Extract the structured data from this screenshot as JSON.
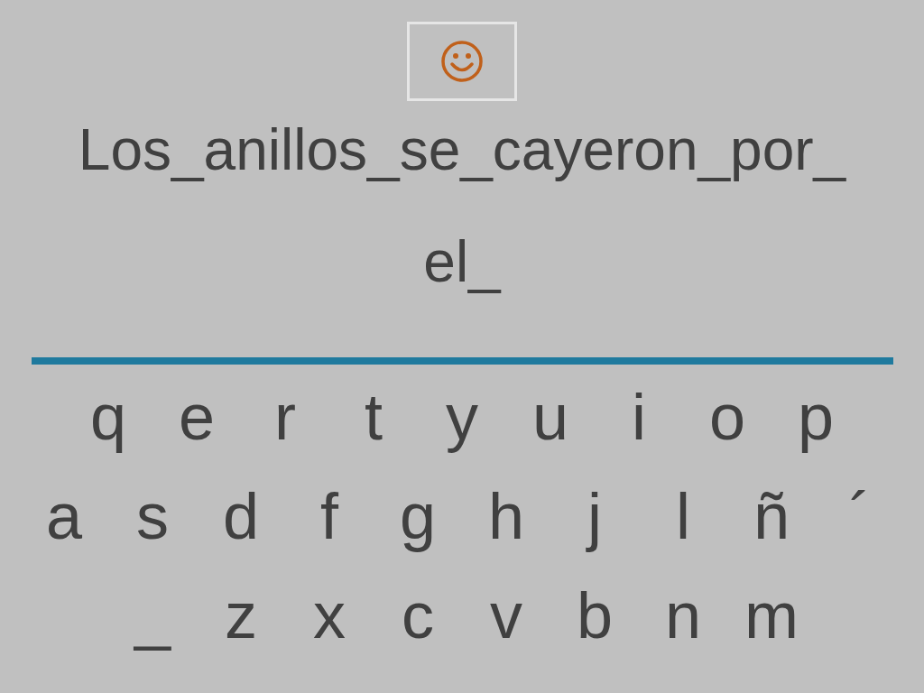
{
  "sentence": {
    "lines": [
      "Los_anillos_se_cayeron_por_",
      "el_"
    ]
  },
  "keyboard": {
    "rows": [
      [
        "q",
        "e",
        "r",
        "t",
        "y",
        "u",
        "i",
        "o",
        "p"
      ],
      [
        "a",
        "s",
        "d",
        "f",
        "g",
        "h",
        "j",
        "l",
        "ñ",
        "´"
      ],
      [
        "_",
        "z",
        "x",
        "c",
        "v",
        "b",
        "n",
        "m"
      ]
    ]
  }
}
